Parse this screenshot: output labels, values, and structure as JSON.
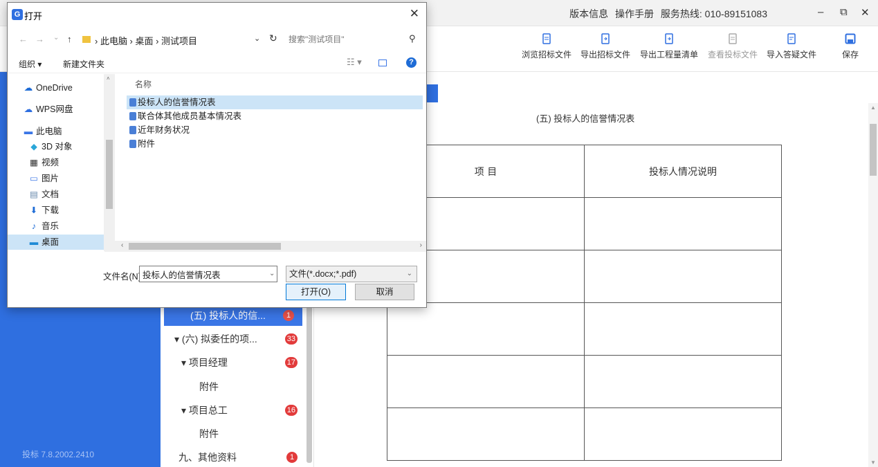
{
  "app": {
    "top_links": [
      "版本信息",
      "操作手册",
      "服务热线: 010-89151083"
    ],
    "window_controls": {
      "minimize": "–",
      "restore": "⧉",
      "close": "✕"
    },
    "toolbar": [
      {
        "label": "浏览招标文件",
        "icon": "doc-view-icon",
        "enabled": true
      },
      {
        "label": "导出招标文件",
        "icon": "doc-export-icon",
        "enabled": true
      },
      {
        "label": "导出工程量清单",
        "icon": "list-export-icon",
        "enabled": true
      },
      {
        "label": "查看投标文件",
        "icon": "doc-search-icon",
        "enabled": false
      },
      {
        "label": "导入答疑文件",
        "icon": "doc-import-icon",
        "enabled": true
      },
      {
        "label": "保存",
        "icon": "save-icon",
        "enabled": true
      }
    ],
    "version": "投标  7.8.2002.2410",
    "tree": [
      {
        "label": "(五) 投标人的信...",
        "badge": "1",
        "selected": true
      },
      {
        "label": "▾  (六) 拟委任的项...",
        "badge": "33"
      },
      {
        "label": "▾ 项目经理",
        "badge": "17"
      },
      {
        "label": "附件",
        "badge": ""
      },
      {
        "label": "▾ 项目总工",
        "badge": "16"
      },
      {
        "label": "附件",
        "badge": ""
      },
      {
        "label": "九、其他资料",
        "badge": "1"
      }
    ],
    "document": {
      "title": "(五) 投标人的信誉情况表",
      "col1": "项 目",
      "col2": "投标人情况说明"
    }
  },
  "dialog": {
    "title": "打开",
    "title_icon": "G",
    "close_glyph": "✕",
    "nav": {
      "back": "←",
      "forward": "→",
      "recent": "⌄",
      "up": "↑"
    },
    "breadcrumb": "› 此电脑 › 桌面 › 测试项目",
    "refresh_glyph": "↻",
    "search_placeholder": "搜索\"测试项目\"",
    "search_glyph": "⚲",
    "organize": "组织 ▾",
    "new_folder": "新建文件夹",
    "view_glyph": "☷ ▾",
    "help_glyph": "?",
    "nav_items": [
      {
        "label": "OneDrive",
        "icon": "☁",
        "color": "#1e6cd6",
        "selected": false
      },
      {
        "label": "WPS网盘",
        "icon": "☁",
        "color": "#2f6fe0",
        "selected": false
      },
      {
        "label": "此电脑",
        "icon": "▬",
        "color": "#3a76e6",
        "selected": false
      },
      {
        "label": "3D 对象",
        "icon": "◆",
        "color": "#2aa6d8",
        "selected": false
      },
      {
        "label": "视频",
        "icon": "▦",
        "color": "#333333",
        "selected": false
      },
      {
        "label": "图片",
        "icon": "▭",
        "color": "#3a76e6",
        "selected": false
      },
      {
        "label": "文档",
        "icon": "▤",
        "color": "#6b8cae",
        "selected": false
      },
      {
        "label": "下载",
        "icon": "⬇",
        "color": "#1e6cd6",
        "selected": false
      },
      {
        "label": "音乐",
        "icon": "♪",
        "color": "#1e6cd6",
        "selected": false
      },
      {
        "label": "桌面",
        "icon": "▬",
        "color": "#1e8ad6",
        "selected": true
      }
    ],
    "column_name": "名称",
    "files": [
      {
        "name": "投标人的信誉情况表",
        "selected": true
      },
      {
        "name": "联合体其他成员基本情况表",
        "selected": false
      },
      {
        "name": "近年财务状况",
        "selected": false
      },
      {
        "name": "附件",
        "selected": false
      }
    ],
    "filename_label": "文件名(N):",
    "filename_value": "投标人的信誉情况表",
    "filetype": "文件(*.docx;*.pdf)",
    "open_label": "打开(O)",
    "cancel_label": "取消"
  }
}
